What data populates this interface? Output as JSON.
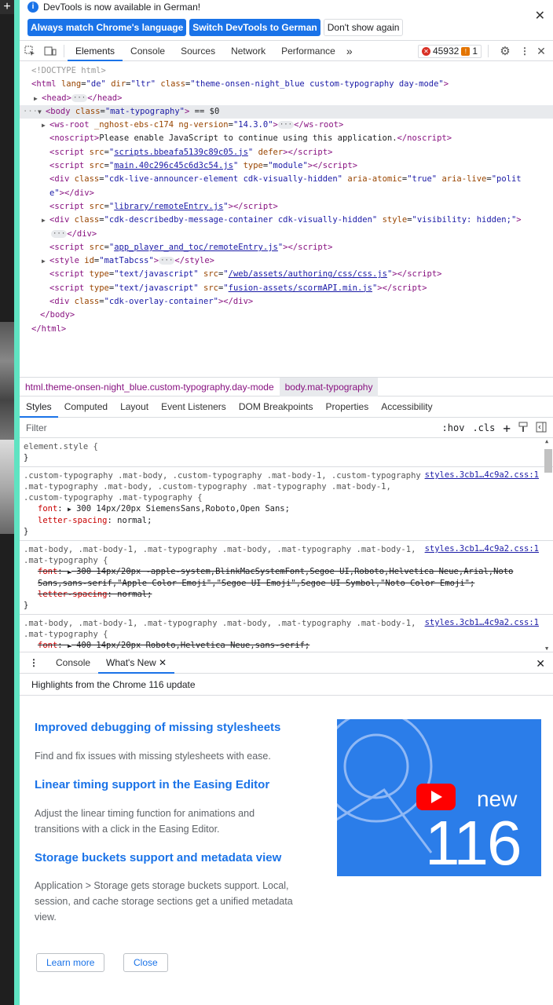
{
  "infobar": {
    "message": "DevTools is now available in German!",
    "btn_match": "Always match Chrome's language",
    "btn_switch": "Switch DevTools to German",
    "btn_dont": "Don't show again"
  },
  "toolbar": {
    "tabs": [
      "Elements",
      "Console",
      "Sources",
      "Network",
      "Performance"
    ],
    "more": "»",
    "errors": "45932",
    "warnings": "1"
  },
  "dom": {
    "l0": "<!DOCTYPE html>",
    "l1_tag": "<html",
    "l1_attrs": [
      {
        "n": "lang",
        "v": "\"de\""
      },
      {
        "n": "dir",
        "v": "\"ltr\""
      },
      {
        "n": "class",
        "v": "\"theme-onsen-night_blue custom-typography day-mode\""
      }
    ],
    "head_open": "<head>",
    "head_close": "</head>",
    "body_open": "<body",
    "body_class": "\"mat-typography\"",
    "body_eq": "== $0",
    "ws_root": "<ws-root",
    "ws_attrs": "_nghost-ebs-c174",
    "ws_ver_n": "ng-version",
    "ws_ver_v": "\"14.3.0\"",
    "ws_close": "</ws-root>",
    "noscript_open": "<noscript>",
    "noscript_text": "Please enable JavaScript to continue using this application.",
    "noscript_close": "</noscript>",
    "script1": "scripts.bbeafa5139c89c05.js",
    "script1_after": "defer",
    "script2": "main.40c296c45c6d3c54.js",
    "script2_type": "\"module\"",
    "div_announcer_class": "\"cdk-live-announcer-element cdk-visually-hidden\"",
    "div_announcer_atomic": "\"true\"",
    "div_announcer_live_a": "\"polit",
    "div_announcer_live_b": "e\"",
    "script3": "library/remoteEntry.js",
    "div_desc_class": "\"cdk-describedby-message-container cdk-visually-hidden\"",
    "div_desc_style": "\"visibility: hidden;\"",
    "script4": "app_player_and_toc/remoteEntry.js",
    "style_id": "\"matTabcss\"",
    "script5": "/web/assets/authoring/css/css.js",
    "script6": "fusion-assets/scormAPI.min.js",
    "type_js": "\"text/javascript\"",
    "overlay_class": "\"cdk-overlay-container\"",
    "body_close": "</body>",
    "html_close": "</html>"
  },
  "crumbs": [
    "html.theme-onsen-night_blue.custom-typography.day-mode",
    "body.mat-typography"
  ],
  "styles_tabs": [
    "Styles",
    "Computed",
    "Layout",
    "Event Listeners",
    "DOM Breakpoints",
    "Properties",
    "Accessibility"
  ],
  "filter": {
    "placeholder": "Filter",
    "hov": ":hov",
    "cls": ".cls"
  },
  "rules": {
    "r0_sel": "element.style {",
    "r0_close": "}",
    "r1_sel": ".custom-typography .mat-body, .custom-typography .mat-body-1, .custom-typography .mat-typography .mat-body, .custom-typography .mat-typography .mat-body-1, .custom-typography .mat-typography {",
    "r1_src": "styles.3cb1…4c9a2.css:1",
    "r1_font_n": "font",
    "r1_font_v": "300 14px/20px SiemensSans,Roboto,Open Sans;",
    "r1_ls_n": "letter-spacing",
    "r1_ls_v": "normal;",
    "r2_sel": ".mat-body, .mat-body-1, .mat-typography .mat-body, .mat-typography .mat-body-1, .mat-typography {",
    "r2_src": "styles.3cb1…4c9a2.css:1",
    "r2_font_v": "300 14px/20px -apple-system,BlinkMacSystemFont,Segoe UI,Roboto,Helvetica Neue,Arial,Noto Sans,sans-serif,\"Apple Color Emoji\",\"Segoe UI Emoji\",Segoe UI Symbol,\"Noto Color Emoji\";",
    "r3_sel": ".mat-body, .mat-body-1, .mat-typography .mat-body, .mat-typography .mat-body-1, .mat-typography {",
    "r3_src": "styles.3cb1…4c9a2.css:1",
    "r3_font_v": "400 14px/20px Roboto,Helvetica Neue,sans-serif;"
  },
  "drawer": {
    "tabs": [
      "Console",
      "What's New"
    ],
    "header": "Highlights from the Chrome 116 update",
    "items": [
      {
        "title": "Improved debugging of missing stylesheets",
        "desc": "Find and fix issues with missing stylesheets with ease."
      },
      {
        "title": "Linear timing support in the Easing Editor",
        "desc": "Adjust the linear timing function for animations and transitions with a click in the Easing Editor."
      },
      {
        "title": "Storage buckets support and metadata view",
        "desc": "Application > Storage gets storage buckets support. Local, session, and cache storage sections get a unified metadata view."
      }
    ],
    "thumb_word": "new",
    "thumb_number": "116",
    "learn_more": "Learn more",
    "close": "Close"
  },
  "colors": {
    "accent": "#1a73e8",
    "strip": "#5fe3c2",
    "youtube": "#ff0000"
  }
}
